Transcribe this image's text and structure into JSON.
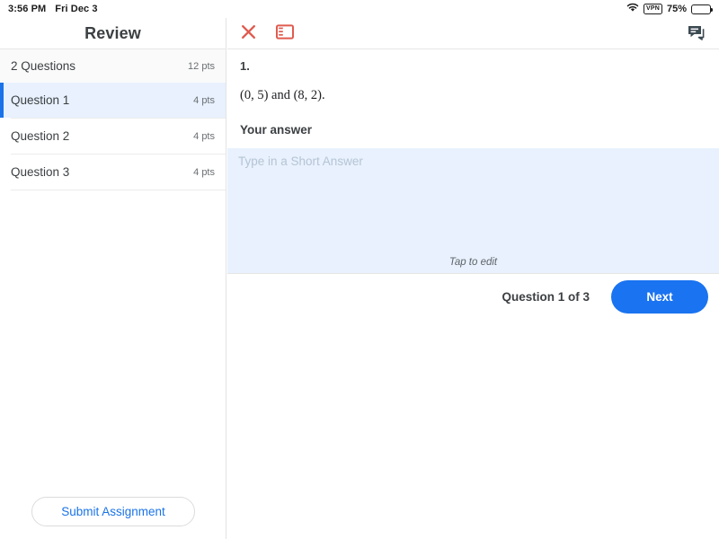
{
  "status_bar": {
    "time": "3:56 PM",
    "date": "Fri Dec 3",
    "wifi_icon": "wifi-icon",
    "vpn_label": "VPN",
    "battery_percent": "75%",
    "battery_icon": "battery-icon"
  },
  "sidebar": {
    "title": "Review",
    "summary": {
      "label": "2 Questions",
      "points": "12 pts"
    },
    "questions": [
      {
        "label": "Question 1",
        "points": "4 pts",
        "selected": true
      },
      {
        "label": "Question 2",
        "points": "4 pts",
        "selected": false
      },
      {
        "label": "Question 3",
        "points": "4 pts",
        "selected": false
      }
    ],
    "submit_label": "Submit Assignment"
  },
  "toolbar": {
    "close_icon": "close-icon",
    "panel_toggle_icon": "sidebar-toggle-icon",
    "comments_icon": "comments-icon",
    "icon_color": "#e05b4f",
    "comments_color": "#3c4a52"
  },
  "question": {
    "number": "1.",
    "prompt": "(0, 5) and (8, 2).",
    "answer_heading": "Your answer",
    "answer_value": "",
    "answer_placeholder": "Type in a Short Answer",
    "edit_hint": "Tap to edit"
  },
  "navigation": {
    "counter": "Question 1 of 3",
    "next_label": "Next"
  },
  "colors": {
    "accent_blue": "#1a73e8",
    "next_button_blue": "#1a73f0",
    "selected_row_bg": "#e8f1fd",
    "answer_box_bg": "#e8f1fd",
    "toolbar_red": "#e05b4f"
  }
}
